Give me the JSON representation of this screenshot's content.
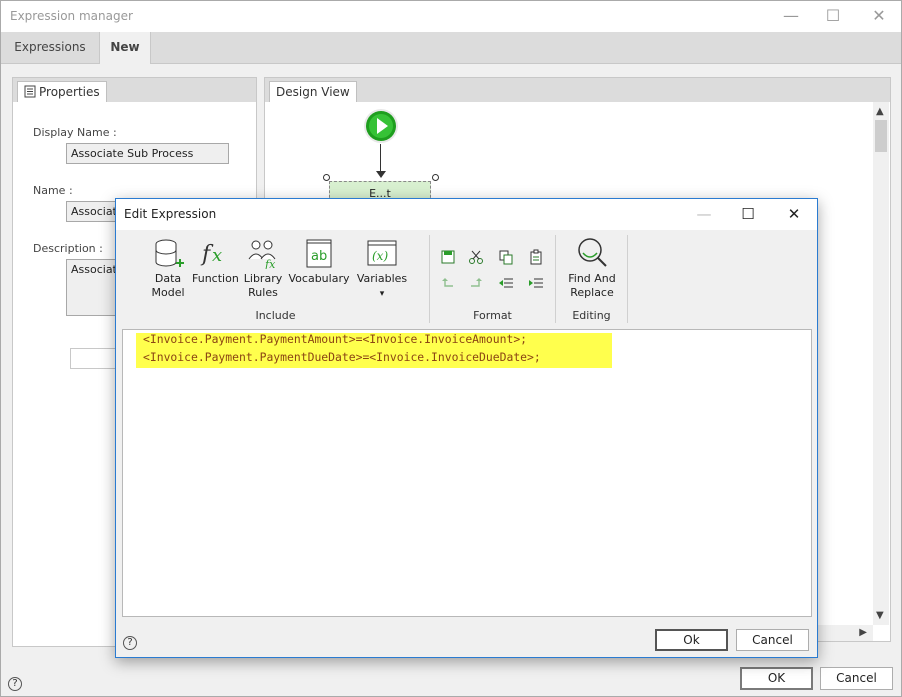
{
  "window": {
    "title": "Expression manager",
    "minimize": "—",
    "maximize": "☐",
    "close": "✕"
  },
  "tabs": [
    {
      "label": "Expressions"
    },
    {
      "label": "New"
    }
  ],
  "properties": {
    "tab_label": "Properties",
    "display_name_label": "Display Name :",
    "display_name_value": "Associate Sub Process",
    "name_label": "Name :",
    "name_value": "Associate",
    "description_label": "Description :",
    "description_value": "Associate"
  },
  "design_view": {
    "tab_label": "Design View",
    "node_label": "E...t"
  },
  "footer": {
    "help": "?",
    "ok_label": "OK",
    "cancel_label": "Cancel"
  },
  "dialog": {
    "title": "Edit Expression",
    "minimize": "—",
    "maximize": "☐",
    "close": "✕",
    "ribbon": {
      "include": {
        "label": "Include",
        "buttons": [
          {
            "label1": "Data",
            "label2": "Model",
            "icon": "database-add-icon"
          },
          {
            "label1": "Function",
            "label2": "",
            "icon": "function-fx-icon"
          },
          {
            "label1": "Library",
            "label2": "Rules",
            "icon": "library-rules-icon"
          },
          {
            "label1": "Vocabulary",
            "label2": "",
            "icon": "vocabulary-icon"
          },
          {
            "label1": "Variables",
            "label2": "▾",
            "icon": "variables-icon"
          }
        ]
      },
      "format": {
        "label": "Format",
        "icons": [
          "save-icon",
          "cut-icon",
          "copy-icon",
          "paste-icon",
          "undo-icon",
          "redo-icon",
          "outdent-icon",
          "indent-icon"
        ]
      },
      "editing": {
        "label": "Editing",
        "button": {
          "label1": "Find And",
          "label2": "Replace",
          "icon": "find-replace-icon"
        }
      }
    },
    "code_lines": [
      "<Invoice.Payment.PaymentAmount>=<Invoice.InvoiceAmount>;",
      "<Invoice.Payment.PaymentDueDate>=<Invoice.InvoiceDueDate>;"
    ],
    "help": "?",
    "ok_label": "Ok",
    "cancel_label": "Cancel"
  },
  "colors": {
    "highlight": "#ffff4d",
    "code_text": "#8b4513",
    "start_node": "#22aa22",
    "dialog_border": "#2a7bd1"
  }
}
